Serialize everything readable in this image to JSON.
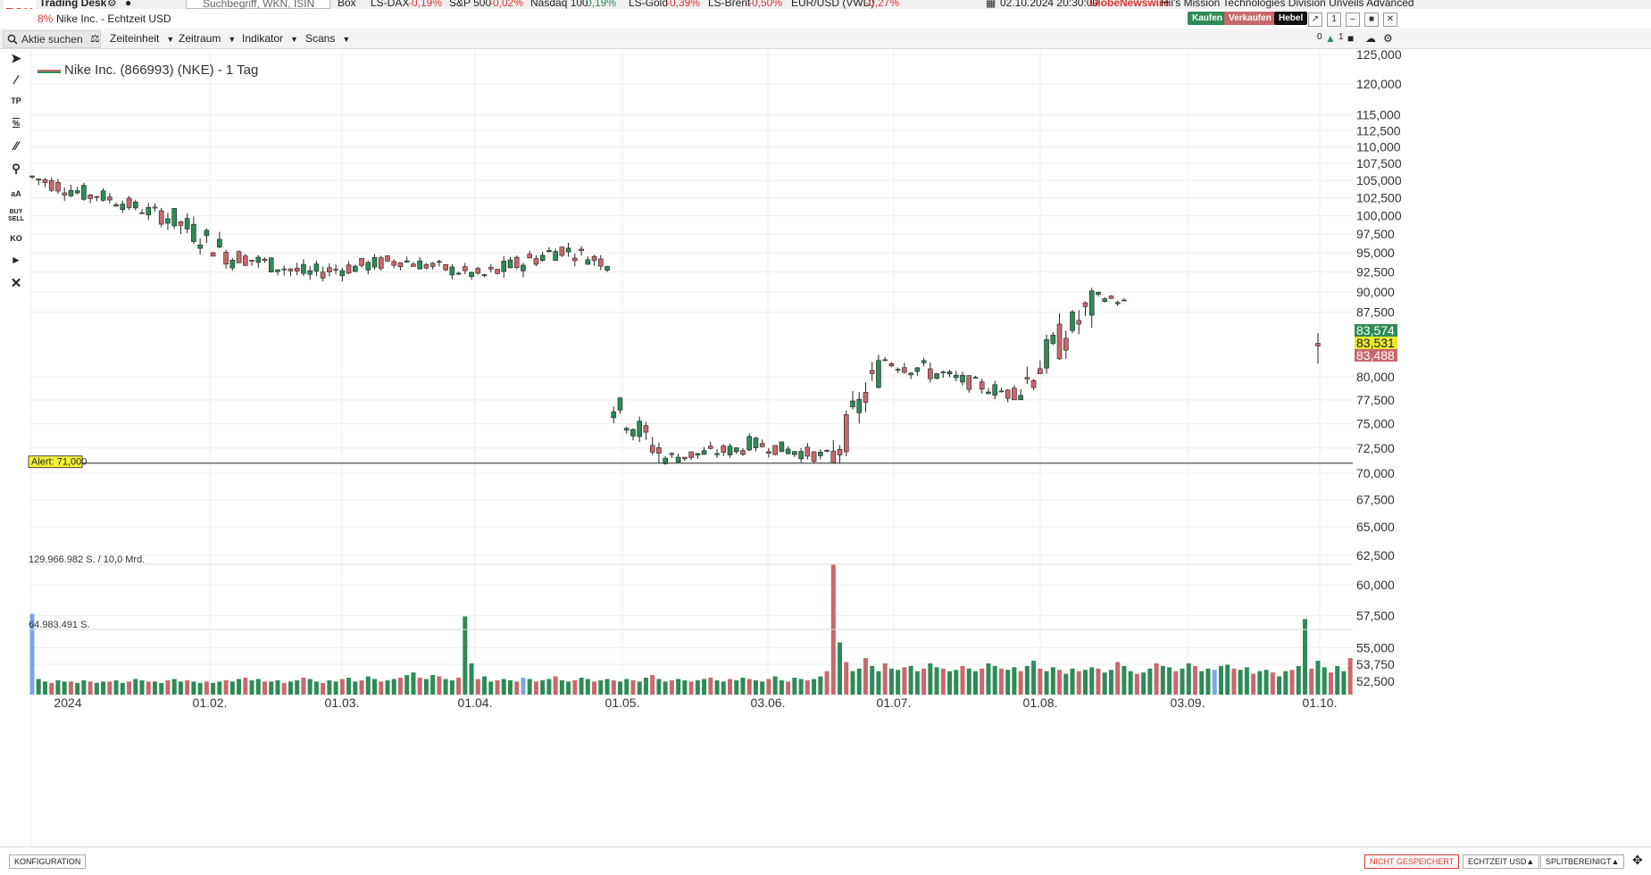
{
  "ticker": {
    "brand": "FOX",
    "app_name": "Trading Desk",
    "search_placeholder": "Suchbegriff, WKN, ISIN",
    "box_label": "Box",
    "items": [
      {
        "name": "LS-DAX",
        "change": "-0,19%"
      },
      {
        "name": "S&P 500",
        "change": "-0,02%"
      },
      {
        "name": "Nasdaq 100",
        "change": "0,19%"
      },
      {
        "name": "LS-Gold",
        "change": "-0,39%"
      },
      {
        "name": "LS-Brent",
        "change": "-0,50%"
      },
      {
        "name": "EUR/USD (VWD)",
        "change": "-0,27%"
      }
    ],
    "news_time": "02.10.2024 20:30:00",
    "news_source": "GlobeNewswire",
    "news_text": "Hii's Mission Technologies Division Unveils Advanced"
  },
  "titlebar": {
    "change_pct": "8%",
    "window_title": "Nike Inc. - Echtzeit USD",
    "buy_label": "Kaufen",
    "sell_label": "Verkaufen",
    "lever_label": "Hebel",
    "window_num": "1"
  },
  "toolbar": {
    "search_placeholder": "Aktie suchen",
    "timeframe_label": "Zeiteinheit",
    "range_label": "Zeitraum",
    "indicator_label": "Indikator",
    "scans_label": "Scans",
    "alerts_count": "0",
    "windows_count": "1"
  },
  "tools": {
    "tp": "TP",
    "pct": "%",
    "text": "aA",
    "buysell": "BUY SELL",
    "ko": "KO"
  },
  "chart_data": {
    "type": "candlestick",
    "title": "Nike Inc. (866993) (NKE) - 1 Tag",
    "y_ticks": [
      125000,
      120000,
      115000,
      112500,
      110000,
      107500,
      105000,
      102500,
      100000,
      97500,
      95000,
      92500,
      90000,
      87500,
      80000,
      77500,
      75000,
      72500,
      70000,
      67500,
      65000,
      62500,
      60000,
      57500,
      55000,
      53750,
      52500
    ],
    "y_tick_labels": [
      "125,000",
      "120,000",
      "115,000",
      "112,500",
      "110,000",
      "107,500",
      "105,000",
      "102,500",
      "100,000",
      "97,500",
      "95,000",
      "92,500",
      "90,000",
      "87,500",
      "80,000",
      "77,500",
      "75,000",
      "72,500",
      "70,000",
      "67,500",
      "65,000",
      "62,500",
      "60,000",
      "57,500",
      "55,000",
      "53,750",
      "52,500"
    ],
    "x_labels": [
      "2024",
      "01.02.",
      "01.03.",
      "01.04.",
      "01.05.",
      "03.06.",
      "01.07.",
      "01.08.",
      "03.09.",
      "01.10."
    ],
    "quotes": {
      "ask": "83,574",
      "last": "83,531",
      "bid": "83,488"
    },
    "alert": {
      "label": "Alert: 71,000",
      "value": 71000
    },
    "volume_labels": {
      "max": "129.966.982 S. / 10,0 Mrd.",
      "half": "64.983.491 S."
    },
    "colors": {
      "up": "#2e8b57",
      "down": "#c9686c",
      "volume_neutral": "#7da6e6",
      "ask": "#2e8b57",
      "last": "#e8e832",
      "bid": "#c9686c"
    },
    "segments": [
      {
        "from": 105500,
        "to": 102500,
        "lo": 100500,
        "hi": 107500
      },
      {
        "from": 103000,
        "to": 100000,
        "lo": 98500,
        "hi": 104500
      },
      {
        "from": 100500,
        "to": 94000,
        "lo": 92000,
        "hi": 102000
      },
      {
        "from": 94500,
        "to": 92000,
        "lo": 89500,
        "hi": 96000
      },
      {
        "from": 92500,
        "to": 94000,
        "lo": 90500,
        "hi": 96500
      },
      {
        "from": 94000,
        "to": 92000,
        "lo": 90500,
        "hi": 95500
      },
      {
        "from": 92000,
        "to": 95500,
        "lo": 91000,
        "hi": 98000
      },
      {
        "from": 95500,
        "to": 93500,
        "lo": 91500,
        "hi": 97500
      },
      {
        "from": 77000,
        "to": 71500,
        "lo": 70500,
        "hi": 79500
      },
      {
        "from": 71500,
        "to": 72500,
        "lo": 70500,
        "hi": 74500
      },
      {
        "from": 73000,
        "to": 71500,
        "lo": 70500,
        "hi": 74500
      },
      {
        "from": 71500,
        "to": 82000,
        "lo": 71000,
        "hi": 82500
      },
      {
        "from": 82000,
        "to": 80000,
        "lo": 77500,
        "hi": 84000
      },
      {
        "from": 80000,
        "to": 78000,
        "lo": 76500,
        "hi": 81000
      },
      {
        "from": 78000,
        "to": 89000,
        "lo": 77500,
        "hi": 90500
      },
      {
        "from": 89500,
        "to": 88500,
        "lo": 87500,
        "hi": 90500
      }
    ],
    "last_bar": {
      "open": 83800,
      "close": 83500,
      "low": 81500,
      "high": 85000
    },
    "volume_values": [
      62,
      12,
      10,
      9,
      11,
      10,
      10,
      9,
      11,
      10,
      9,
      10,
      10,
      11,
      9,
      10,
      12,
      11,
      10,
      10,
      9,
      11,
      12,
      10,
      11,
      10,
      9,
      10,
      9,
      10,
      11,
      10,
      12,
      13,
      11,
      12,
      10,
      10,
      11,
      9,
      10,
      11,
      13,
      12,
      10,
      9,
      11,
      10,
      12,
      13,
      10,
      11,
      14,
      12,
      10,
      11,
      12,
      13,
      15,
      17,
      13,
      12,
      15,
      14,
      12,
      11,
      13,
      60,
      24,
      12,
      14,
      10,
      11,
      12,
      11,
      10,
      13,
      12,
      10,
      11,
      12,
      14,
      11,
      10,
      11,
      13,
      12,
      10,
      11,
      12,
      11,
      10,
      12,
      11,
      10,
      13,
      15,
      12,
      10,
      11,
      12,
      11,
      10,
      11,
      12,
      13,
      11,
      10,
      12,
      11,
      13,
      12,
      11,
      10,
      12,
      14,
      11,
      10,
      13,
      12,
      11,
      12,
      14,
      18,
      100,
      40,
      25,
      18,
      20,
      28,
      22,
      18,
      24,
      20,
      19,
      21,
      22,
      18,
      20,
      24,
      21,
      20,
      18,
      19,
      22,
      20,
      18,
      20,
      24,
      22,
      20,
      19,
      21,
      18,
      22,
      26,
      20,
      18,
      21,
      19,
      16,
      20,
      18,
      19,
      21,
      20,
      17,
      19,
      25,
      22,
      18,
      16,
      17,
      20,
      24,
      22,
      21,
      18,
      20,
      24,
      22,
      18,
      20,
      19,
      22,
      23,
      20,
      19,
      21,
      16,
      18,
      19,
      17,
      14,
      18,
      19,
      22,
      58,
      20,
      26,
      21,
      17,
      22,
      18,
      28
    ]
  },
  "statusbar": {
    "config_label": "KONFIGURATION",
    "not_saved_label": "NICHT GESPEICHERT",
    "realtime_label": "ECHTZEIT USD▲",
    "split_label": "SPLITBEREINIGT▲"
  }
}
